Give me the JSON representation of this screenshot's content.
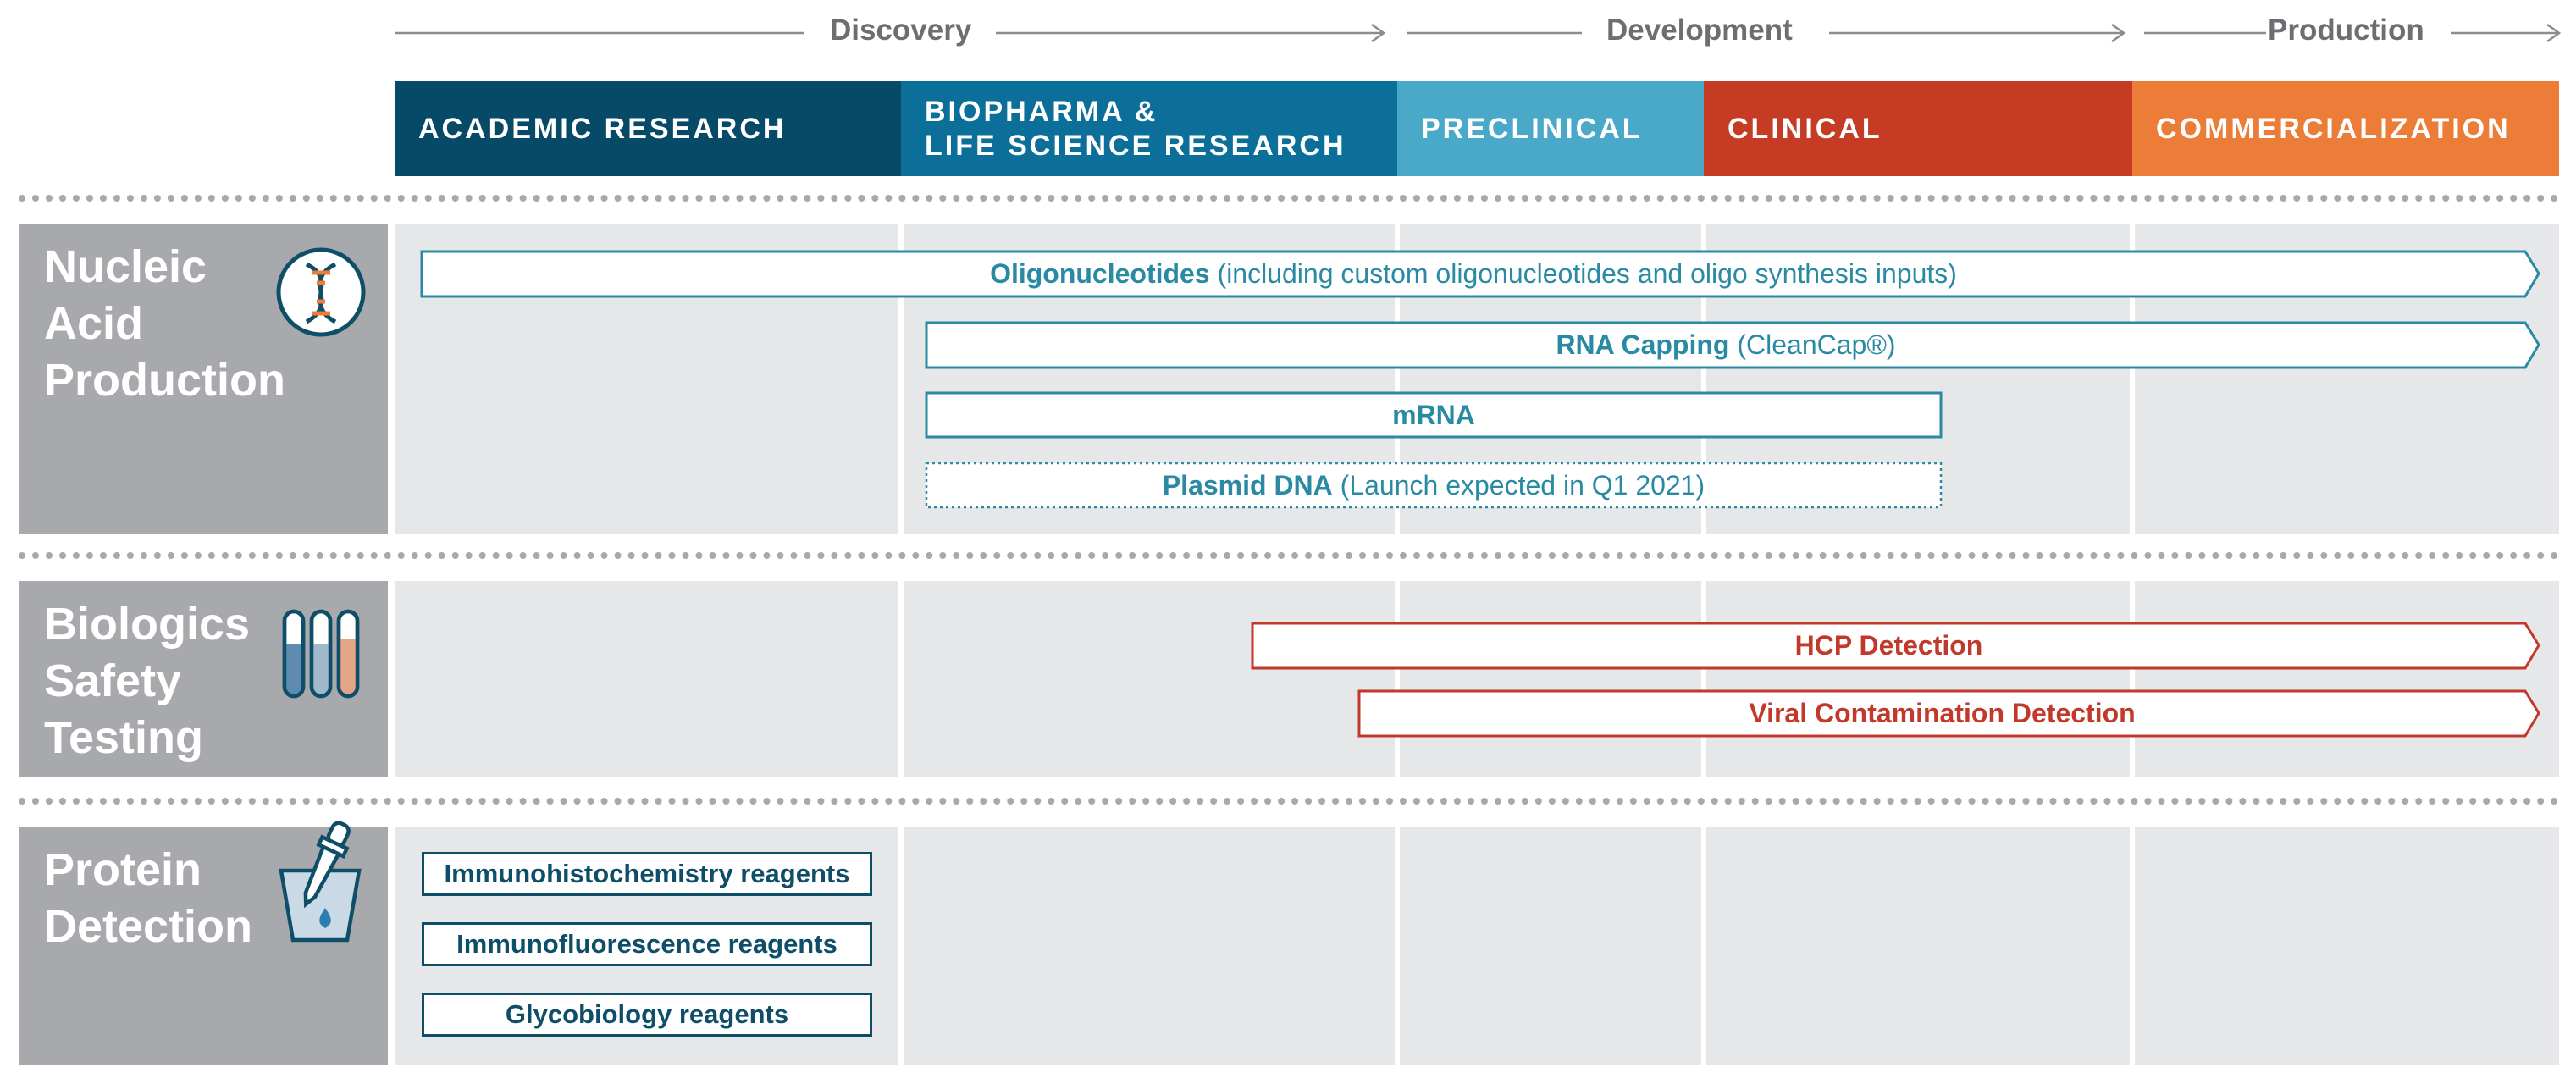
{
  "phases": [
    {
      "label": "Discovery"
    },
    {
      "label": "Development"
    },
    {
      "label": "Production"
    }
  ],
  "stages": [
    {
      "label_line1": "ACADEMIC RESEARCH",
      "label_line2": "",
      "color": "#064a67"
    },
    {
      "label_line1": "BIOPHARMA &",
      "label_line2": "LIFE SCIENCE RESEARCH",
      "color": "#0b6f99"
    },
    {
      "label_line1": "PRECLINICAL",
      "label_line2": "",
      "color": "#4aa8c8"
    },
    {
      "label_line1": "CLINICAL",
      "label_line2": "",
      "color": "#c63b23"
    },
    {
      "label_line1": "COMMERCIALIZATION",
      "label_line2": "",
      "color": "#ec7d38"
    }
  ],
  "rows": [
    {
      "title_lines": [
        "Nucleic",
        "Acid",
        "Production"
      ],
      "icon": "dna-icon",
      "bars": [
        {
          "bold": "Oligonucleotides",
          "rest": " (including custom oligonucleotides and oligo synthesis inputs)"
        },
        {
          "bold": "RNA Capping",
          "rest": " (CleanCap®)"
        },
        {
          "bold": "mRNA",
          "rest": ""
        },
        {
          "bold": "Plasmid DNA",
          "rest": " (Launch expected in Q1 2021)"
        }
      ]
    },
    {
      "title_lines": [
        "Biologics",
        "Safety",
        "Testing"
      ],
      "icon": "test-tubes-icon",
      "bars": [
        {
          "bold": "HCP Detection",
          "rest": ""
        },
        {
          "bold": "Viral Contamination Detection",
          "rest": ""
        }
      ]
    },
    {
      "title_lines": [
        "Protein",
        "Detection"
      ],
      "icon": "dropper-icon",
      "boxes": [
        {
          "label": "Immunohistochemistry reagents"
        },
        {
          "label": "Immunofluorescence reagents"
        },
        {
          "label": "Glycobiology reagents"
        }
      ]
    }
  ],
  "colors": {
    "teal": "#2a8aa4",
    "red": "#c0392b",
    "navy": "#0e4e68",
    "gray_label": "#a7a9ac",
    "grid_bg": "#e6e7e8"
  }
}
